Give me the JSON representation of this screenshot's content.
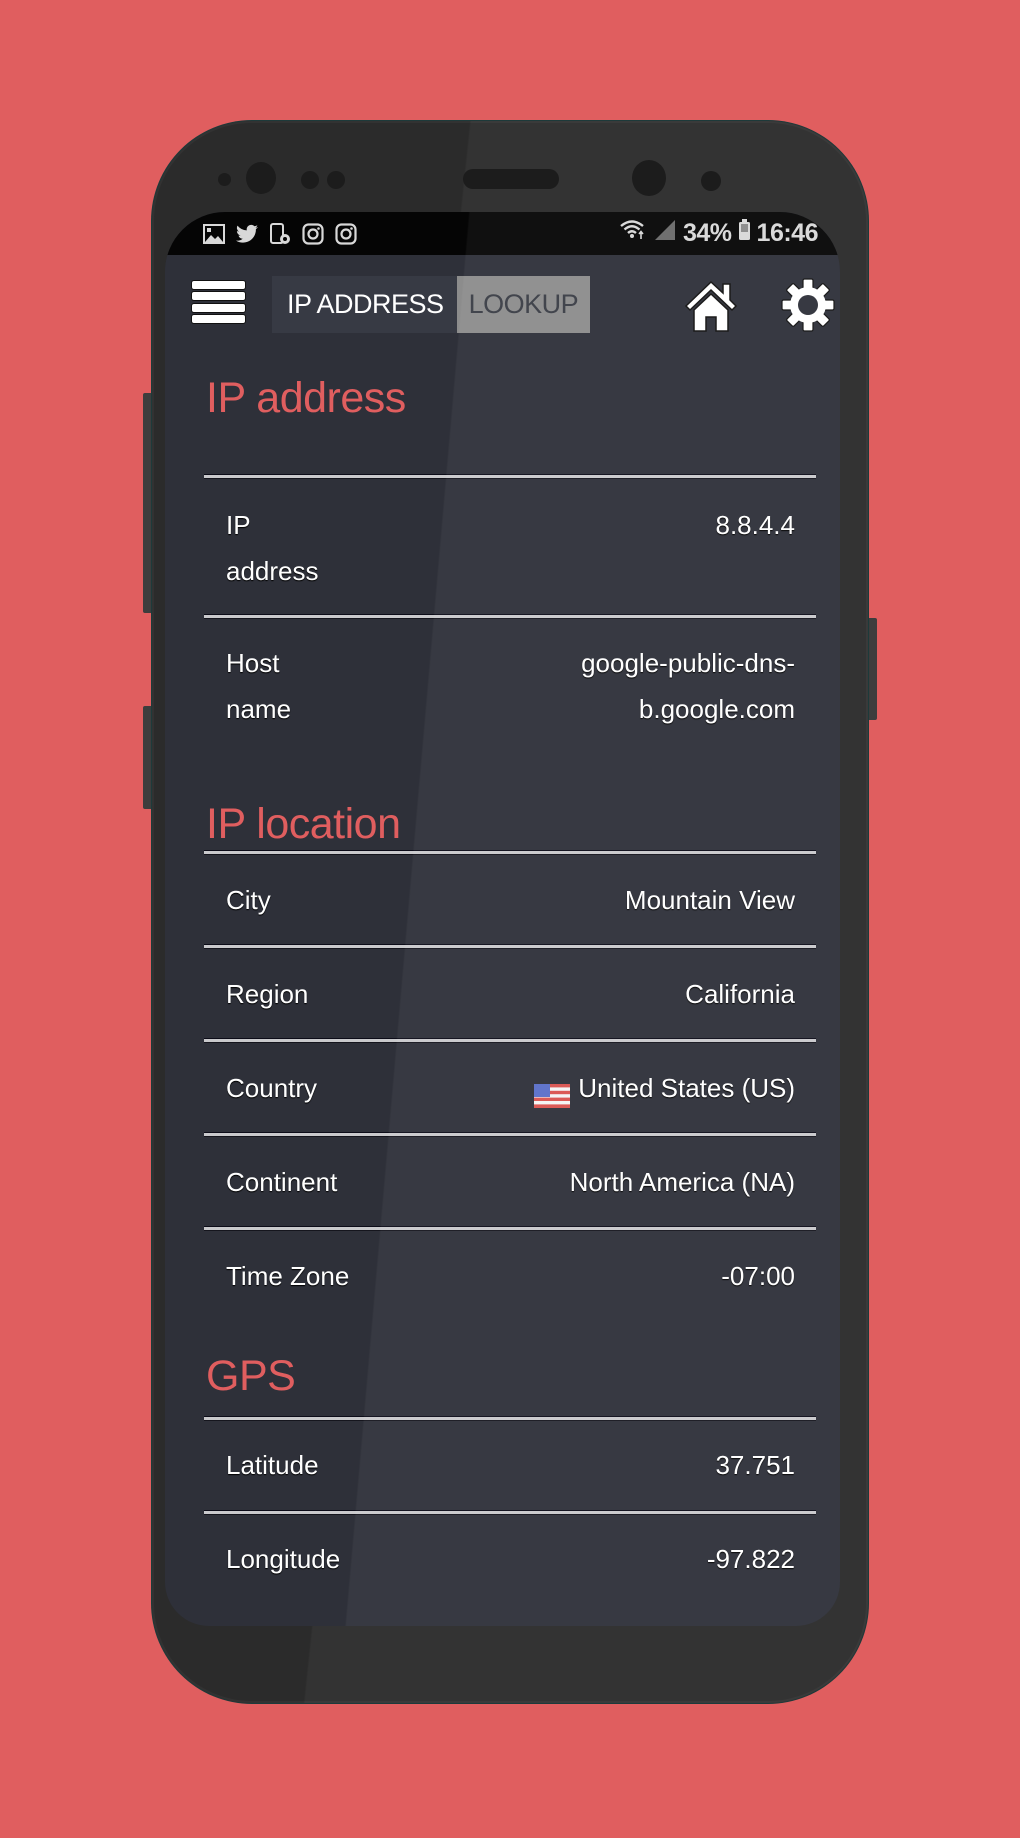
{
  "status_bar": {
    "notification_icons": [
      "gallery-icon",
      "twitter-icon",
      "phone-lock-icon",
      "instagram-icon",
      "instagram-icon"
    ],
    "wifi_icon": "wifi-icon",
    "signal_icon": "signal-icon",
    "battery_percent": "34%",
    "battery_icon": "battery-icon",
    "time": "16:46"
  },
  "toolbar": {
    "menu_icon": "hamburger-menu-icon",
    "title_main": "IP ADDRESS",
    "title_sub": "LOOKUP",
    "home_icon": "home-icon",
    "settings_icon": "gear-icon"
  },
  "colors": {
    "background": "#e05e5f",
    "accent": "#e05e5f",
    "screen": "#2e3039",
    "lookup_badge": "#8c8c8c"
  },
  "sections": [
    {
      "title": "IP address",
      "rows": [
        {
          "label": "IP address",
          "label_lines": [
            "IP",
            "address"
          ],
          "value_lines": [
            "8.8.4.4"
          ]
        },
        {
          "label": "Host name",
          "label_lines": [
            "Host",
            "name"
          ],
          "value_lines": [
            "google-public-dns-",
            "b.google.com"
          ]
        }
      ]
    },
    {
      "title": "IP location",
      "rows": [
        {
          "label": "City",
          "value": "Mountain View"
        },
        {
          "label": "Region",
          "value": "California"
        },
        {
          "label": "Country",
          "value": "United States (US)",
          "flag_icon": "us-flag-icon"
        },
        {
          "label": "Continent",
          "value": "North America (NA)"
        },
        {
          "label": "Time Zone",
          "value": "-07:00"
        }
      ]
    },
    {
      "title": "GPS",
      "rows": [
        {
          "label": "Latitude",
          "value": "37.751"
        },
        {
          "label": "Longitude",
          "value": "-97.822"
        }
      ]
    }
  ]
}
